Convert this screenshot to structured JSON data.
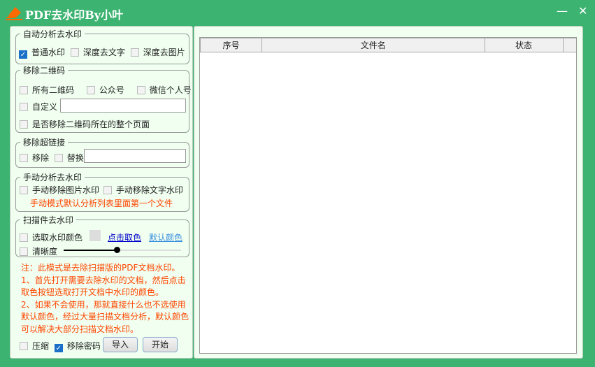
{
  "window": {
    "title": "PDF去水印By小叶",
    "minimize": "—",
    "close": "✕"
  },
  "auto": {
    "legend": "自动分析去水印",
    "normal": "普通水印",
    "deep_text": "深度去文字",
    "deep_image": "深度去图片"
  },
  "qr": {
    "legend": "移除二维码",
    "all": "所有二维码",
    "official": "公众号",
    "wechat": "微信个人号",
    "custom": "自定义",
    "custom_value": "",
    "whole_page": "是否移除二维码所在的整个页面"
  },
  "link": {
    "legend": "移除超链接",
    "remove": "移除",
    "replace": "替换",
    "replace_value": ""
  },
  "manual": {
    "legend": "手动分析去水印",
    "image": "手动移除图片水印",
    "text": "手动移除文字水印",
    "hint": "手动模式默认分析列表里面第一个文件"
  },
  "scan": {
    "legend": "扫描件去水印",
    "pick": "选取水印颜色",
    "click_pick": "点击取色",
    "default_color": "默认颜色",
    "clarity": "清晰度",
    "clarity_value": 0.45
  },
  "notes": [
    "注：此模式是去除扫描版的PDF文档水印。",
    "1、首先打开需要去除水印的文档，然后点击取色按钮选取打开文档中水印的颜色。",
    "2、如果不会使用，那就直接什么也不选使用默认颜色，经过大量扫描文档分析，默认颜色可以解决大部分扫描文档水印。"
  ],
  "bottom": {
    "compress": "压缩",
    "remove_password": "移除密码",
    "import": "导入",
    "start": "开始"
  },
  "table": {
    "columns": [
      "序号",
      "文件名",
      "状态"
    ]
  }
}
